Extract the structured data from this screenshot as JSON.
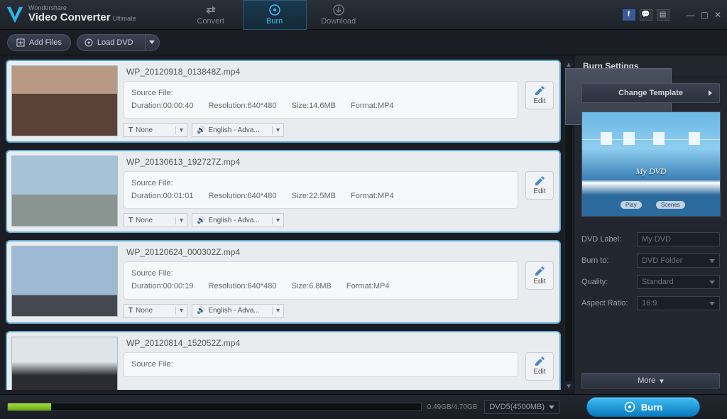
{
  "brand": {
    "top": "Wondershare",
    "name": "Video Converter",
    "edition": "Ultimate"
  },
  "tabs": {
    "convert": "Convert",
    "burn": "Burn",
    "download": "Download"
  },
  "toolbar": {
    "add_files": "Add Files",
    "load_dvd": "Load DVD"
  },
  "labels": {
    "source_file": "Source File:",
    "duration": "Duration:",
    "resolution": "Resolution:",
    "size": "Size:",
    "format": "Format:",
    "edit": "Edit"
  },
  "subtitle_default": "None",
  "audio_default": "English - Adva...",
  "items": [
    {
      "filename": "WP_20120918_013848Z.mp4",
      "duration": "00:00:40",
      "resolution": "640*480",
      "size": "14.6MB",
      "format": "MP4"
    },
    {
      "filename": "WP_20130613_192727Z.mp4",
      "duration": "00:01:01",
      "resolution": "640*480",
      "size": "22.5MB",
      "format": "MP4"
    },
    {
      "filename": "WP_20120624_000302Z.mp4",
      "duration": "00:00:19",
      "resolution": "640*480",
      "size": "6.8MB",
      "format": "MP4"
    },
    {
      "filename": "WP_20120814_152052Z.mp4",
      "duration": "",
      "resolution": "",
      "size": "",
      "format": ""
    }
  ],
  "side": {
    "title": "Burn Settings",
    "change_template": "Change Template",
    "preview_title": "My DVD",
    "preview_play": "Play",
    "preview_scenes": "Scenes",
    "dvd_label_lab": "DVD Label:",
    "dvd_label_val": "My DVD",
    "burn_to_lab": "Burn to:",
    "burn_to_val": "DVD Folder",
    "quality_lab": "Quality:",
    "quality_val": "Standard",
    "aspect_lab": "Aspect Ratio:",
    "aspect_val": "16:9",
    "more": "More"
  },
  "footer": {
    "usage": "0.49GB/4.70GB",
    "disc": "DVD5(4500MB)",
    "burn": "Burn"
  }
}
